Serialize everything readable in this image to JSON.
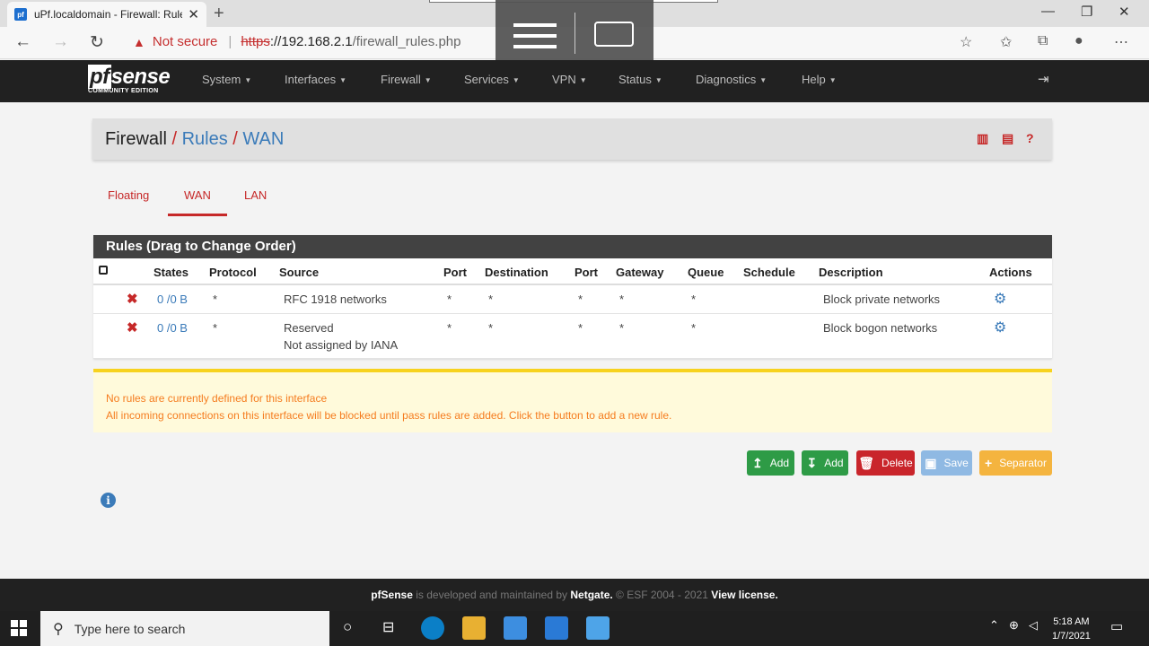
{
  "browser": {
    "tab_title": "uPf.localdomain - Firewall: Rules: WAN",
    "url_warning": "Not secure",
    "url_scheme": "https",
    "url_host": "://192.168.2.1",
    "url_path": "/firewall_rules.php"
  },
  "nav": {
    "logo": "sense",
    "logo_pf": "pf",
    "logo_sub": "COMMUNITY EDITION",
    "menu": [
      "System",
      "Interfaces",
      "Firewall",
      "Services",
      "VPN",
      "Status",
      "Diagnostics",
      "Help"
    ]
  },
  "breadcrumb": {
    "root": "Firewall",
    "level2": "Rules",
    "level3": "WAN",
    "sep": "/"
  },
  "tabs": [
    "Floating",
    "WAN",
    "LAN"
  ],
  "active_tab": "WAN",
  "rules": {
    "panel_title": "Rules (Drag to Change Order)",
    "columns": [
      "States",
      "Protocol",
      "Source",
      "Port",
      "Destination",
      "Port",
      "Gateway",
      "Queue",
      "Schedule",
      "Description",
      "Actions"
    ],
    "rows": [
      {
        "states": "0 /0 B",
        "protocol": "*",
        "source": "RFC 1918 networks",
        "source2": "",
        "port": "*",
        "destination": "*",
        "dport": "*",
        "gateway": "*",
        "queue": "*",
        "schedule": "",
        "description": "Block private networks"
      },
      {
        "states": "0 /0 B",
        "protocol": "*",
        "source": "Reserved",
        "source2": "Not assigned by IANA",
        "port": "*",
        "destination": "*",
        "dport": "*",
        "gateway": "*",
        "queue": "*",
        "schedule": "",
        "description": "Block bogon networks"
      }
    ]
  },
  "warning": {
    "line1": "No rules are currently defined for this interface",
    "line2": "All incoming connections on this interface will be blocked until pass rules are added. Click the button to add a new rule."
  },
  "buttons": {
    "add_top": "Add",
    "add_bottom": "Add",
    "delete": "Delete",
    "save": "Save",
    "separator": "Separator"
  },
  "footer": {
    "brand": "pfSense",
    "text1": " is developed and maintained by ",
    "company": "Netgate.",
    "text2": " © ESF 2004 - 2021 ",
    "license": "View license."
  },
  "taskbar": {
    "search_placeholder": "Type here to search",
    "time": "5:18 AM",
    "date": "1/7/2021"
  },
  "colors": {
    "accent_red": "#c62828",
    "link_blue": "#3b7bb9",
    "nav_bg": "#212121",
    "add_green": "#2e9b46",
    "delete_red": "#c9252b",
    "save_blue": "#8fb9e3",
    "separator_orange": "#f4b43f"
  }
}
